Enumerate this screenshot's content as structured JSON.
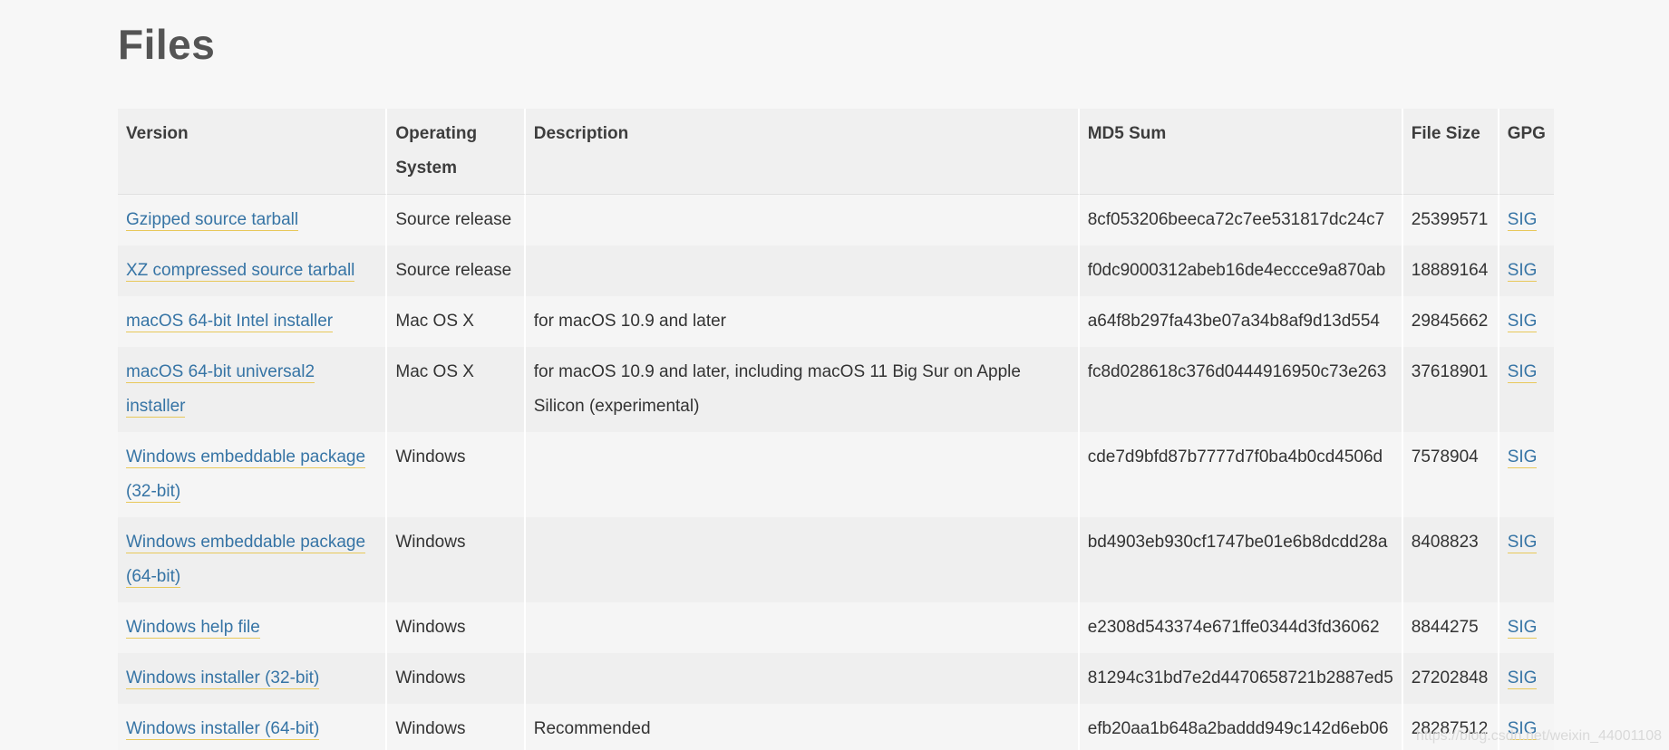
{
  "page": {
    "title": "Files",
    "watermark": "https://blog.csdn.net/weixin_44001108"
  },
  "table": {
    "headers": {
      "version": "Version",
      "os": "Operating System",
      "description": "Description",
      "md5": "MD5 Sum",
      "size": "File Size",
      "gpg": "GPG"
    },
    "rows": [
      {
        "version": "Gzipped source tarball",
        "os": "Source release",
        "description": "",
        "md5": "8cf053206beeca72c7ee531817dc24c7",
        "size": "25399571",
        "gpg": "SIG"
      },
      {
        "version": "XZ compressed source tarball",
        "os": "Source release",
        "description": "",
        "md5": "f0dc9000312abeb16de4eccce9a870ab",
        "size": "18889164",
        "gpg": "SIG"
      },
      {
        "version": "macOS 64-bit Intel installer",
        "os": "Mac OS X",
        "description": "for macOS 10.9 and later",
        "md5": "a64f8b297fa43be07a34b8af9d13d554",
        "size": "29845662",
        "gpg": "SIG"
      },
      {
        "version": "macOS 64-bit universal2 installer",
        "os": "Mac OS X",
        "description": "for macOS 10.9 and later, including macOS 11 Big Sur on Apple Silicon (experimental)",
        "md5": "fc8d028618c376d0444916950c73e263",
        "size": "37618901",
        "gpg": "SIG"
      },
      {
        "version": "Windows embeddable package (32-bit)",
        "os": "Windows",
        "description": "",
        "md5": "cde7d9bfd87b7777d7f0ba4b0cd4506d",
        "size": "7578904",
        "gpg": "SIG"
      },
      {
        "version": "Windows embeddable package (64-bit)",
        "os": "Windows",
        "description": "",
        "md5": "bd4903eb930cf1747be01e6b8dcdd28a",
        "size": "8408823",
        "gpg": "SIG"
      },
      {
        "version": "Windows help file",
        "os": "Windows",
        "description": "",
        "md5": "e2308d543374e671ffe0344d3fd36062",
        "size": "8844275",
        "gpg": "SIG"
      },
      {
        "version": "Windows installer (32-bit)",
        "os": "Windows",
        "description": "",
        "md5": "81294c31bd7e2d4470658721b2887ed5",
        "size": "27202848",
        "gpg": "SIG"
      },
      {
        "version": "Windows installer (64-bit)",
        "os": "Windows",
        "description": "Recommended",
        "md5": "efb20aa1b648a2baddd949c142d6eb06",
        "size": "28287512",
        "gpg": "SIG"
      }
    ]
  },
  "colors": {
    "link": "#3674a5",
    "link_underline": "#e8c85a",
    "title": "#545454",
    "header_bg": "#f0f0f0"
  }
}
